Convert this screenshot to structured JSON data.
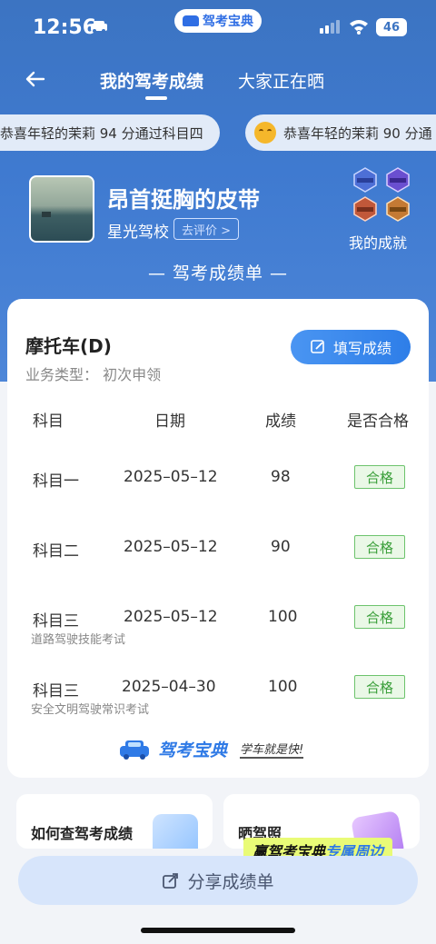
{
  "status_bar": {
    "time": "12:56",
    "app_pill": "驾考宝典",
    "battery": "46"
  },
  "nav": {
    "tab_active": "我的驾考成绩",
    "tab_other": "大家正在晒"
  },
  "marquee": [
    {
      "text": "恭喜年轻的茉莉 94 分通过科目四"
    },
    {
      "text": "恭喜年轻的茉莉 90 分通"
    }
  ],
  "profile": {
    "name": "昂首挺胸的皮带",
    "school": "星光驾校",
    "rate_label": "去评价 >",
    "achievements_label": "我的成就"
  },
  "sheet_title": "— 驾考成绩单 —",
  "card": {
    "vehicle_type": "摩托车(D)",
    "business_type": "业务类型：  初次申领",
    "fill_button": "填写成绩",
    "headers": {
      "subject": "科目",
      "date": "日期",
      "score": "成绩",
      "passed": "是否合格"
    },
    "rows": [
      {
        "subject": "科目一",
        "date": "2025–05–12",
        "score": "98",
        "status": "合格",
        "note": ""
      },
      {
        "subject": "科目二",
        "date": "2025–05–12",
        "score": "90",
        "status": "合格",
        "note": ""
      },
      {
        "subject": "科目三",
        "date": "2025–05–12",
        "score": "100",
        "status": "合格",
        "note": "道路驾驶技能考试"
      },
      {
        "subject": "科目三",
        "date": "2025–04–30",
        "score": "100",
        "status": "合格",
        "note": "安全文明驾驶常识考试"
      }
    ],
    "brand_name": "驾考宝典",
    "brand_slogan": "学车就是快!"
  },
  "tiles": {
    "tile1": "如何查驾考成绩",
    "tile2": "晒驾照"
  },
  "promo": {
    "prefix": "赢驾考宝典",
    "highlight": "专属周边"
  },
  "share_button": "分享成绩单",
  "colors": {
    "accent": "#2f7ae6",
    "pass_green": "#3a9f3a",
    "hero_blue": "#3c74c2"
  }
}
